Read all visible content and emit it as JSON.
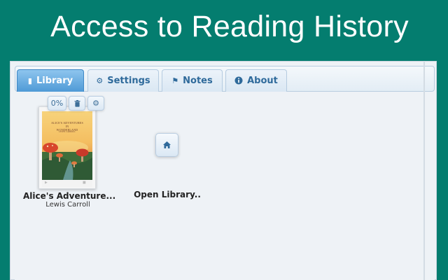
{
  "banner": {
    "title": "Access to Reading History"
  },
  "tabs": [
    {
      "label": "Library",
      "icon": "book-icon",
      "active": true
    },
    {
      "label": "Settings",
      "icon": "gear-icon",
      "active": false
    },
    {
      "label": "Notes",
      "icon": "flag-icon",
      "active": false
    },
    {
      "label": "About",
      "icon": "info-icon",
      "active": false
    }
  ],
  "book": {
    "progress": "0%",
    "title": "Alice's Adventure...",
    "author": "Lewis Carroll",
    "cover_title_line1": "ALICE'S ADVENTURES",
    "cover_title_line2": "IN",
    "cover_title_line3": "WONDERLAND",
    "cover_author": "LEWIS CARROLL",
    "actions": [
      {
        "name": "progress",
        "icon": ""
      },
      {
        "name": "delete",
        "icon": "trash-icon"
      },
      {
        "name": "settings",
        "icon": "gear-icon"
      }
    ]
  },
  "open_library": {
    "label": "Open Library..",
    "icon": "home-icon"
  },
  "colors": {
    "banner_bg": "#047d6f",
    "tab_active": "#4f9ad6",
    "tab_text": "#2f6a9b",
    "content_bg": "#eef2f6"
  }
}
